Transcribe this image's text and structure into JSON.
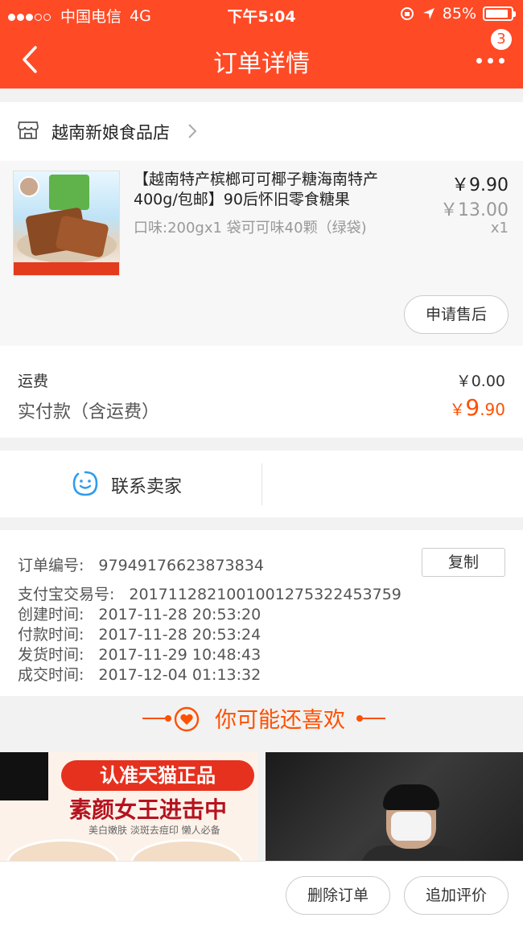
{
  "status_bar": {
    "carrier": "中国电信",
    "network": "4G",
    "time": "下午5:04",
    "battery": "85%"
  },
  "nav": {
    "title": "订单详情",
    "badge": "3"
  },
  "store": {
    "name": "越南新娘食品店"
  },
  "product": {
    "title": "【越南特产槟榔可可椰子糖海南特产400g/包邮】90后怀旧零食糖果",
    "spec": "口味:200gx1 袋可可味40颗（绿袋)",
    "price": "￥9.90",
    "original_price": "￥13.00",
    "quantity": "x1",
    "aftersale_label": "申请售后"
  },
  "fees": {
    "shipping_label": "运费",
    "shipping_value": "￥0.00",
    "paid_label": "实付款（含运费）",
    "paid_currency": "￥",
    "paid_int": "9",
    "paid_dec": ".90"
  },
  "contact": {
    "label": "联系卖家"
  },
  "order_info": {
    "copy_label": "复制",
    "rows": [
      {
        "key": "订单编号:",
        "value": "97949176623873834"
      },
      {
        "key": "支付宝交易号:",
        "value": "2017112821001001275322453759"
      },
      {
        "key": "创建时间:",
        "value": "2017-11-28 20:53:20"
      },
      {
        "key": "付款时间:",
        "value": "2017-11-28 20:53:24"
      },
      {
        "key": "发货时间:",
        "value": "2017-11-29 10:48:43"
      },
      {
        "key": "成交时间:",
        "value": "2017-12-04 01:13:32"
      }
    ]
  },
  "recommend": {
    "title": "你可能还喜欢",
    "item1_banner": "认准天猫正品",
    "item1_headline": "素颜女王进击中",
    "item1_sub": "美白嫩肤 淡斑去痘印 懒人必备"
  },
  "bottom": {
    "delete_label": "删除订单",
    "review_label": "追加评价"
  },
  "colors": {
    "brand": "#ff4a26",
    "price": "#ff5000"
  }
}
